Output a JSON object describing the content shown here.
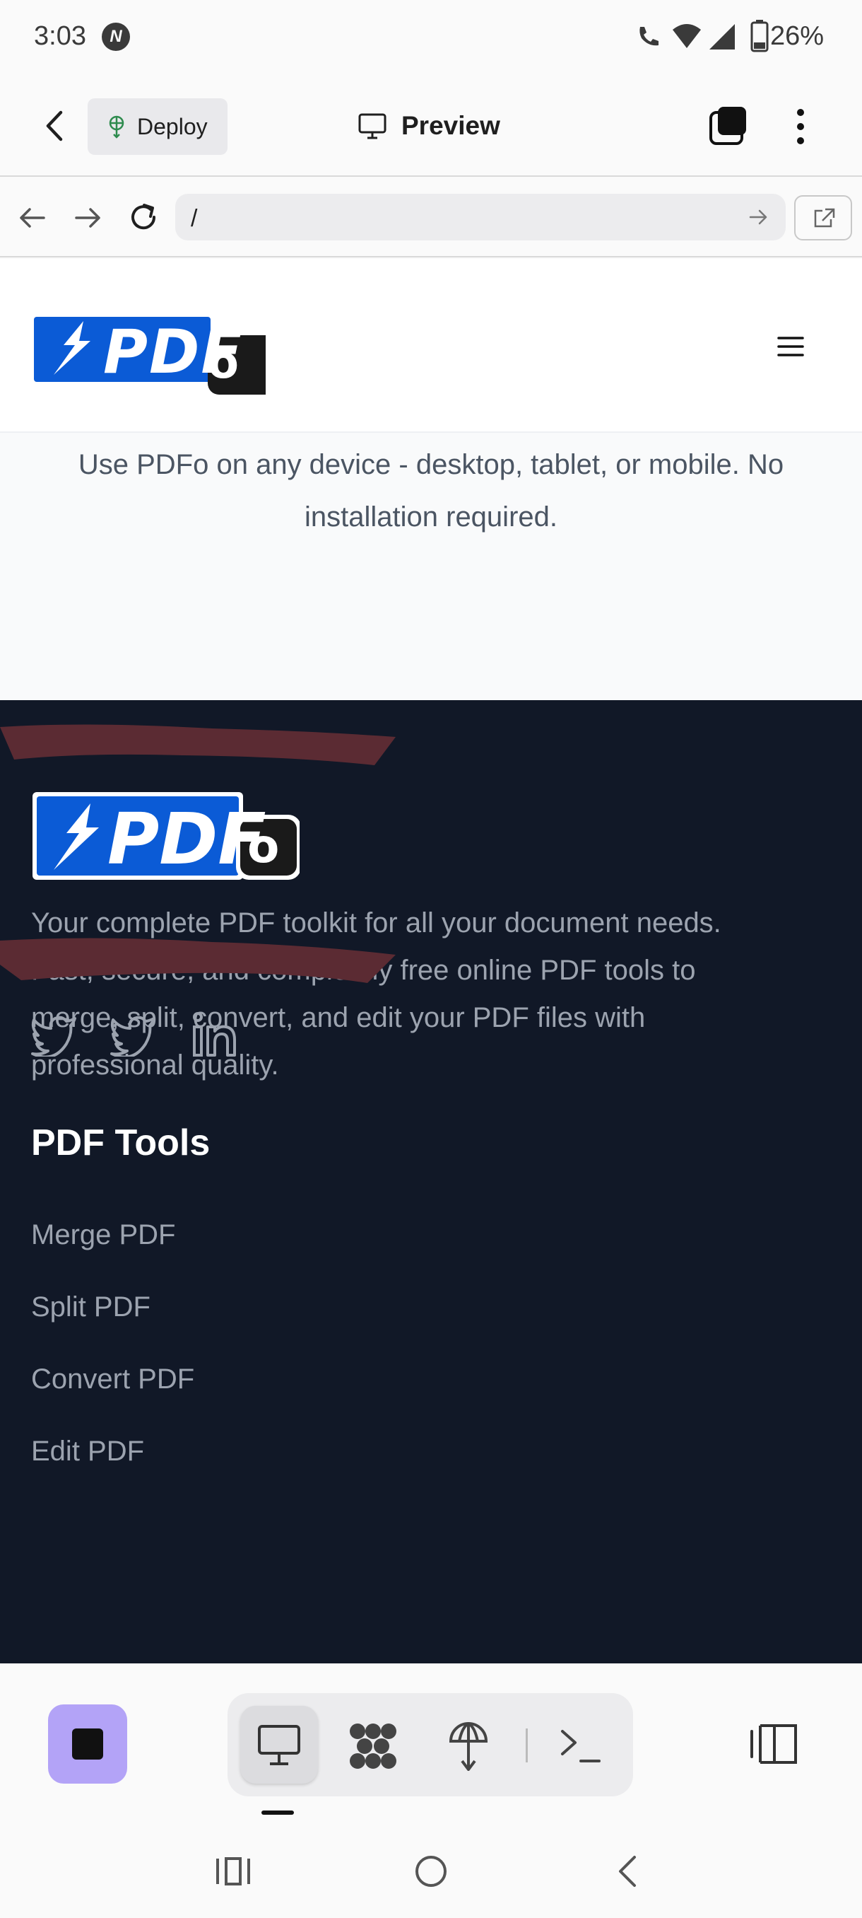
{
  "status_bar": {
    "time": "3:03",
    "battery": "26%"
  },
  "app_bar": {
    "deploy_label": "Deploy",
    "preview_label": "Preview"
  },
  "url_bar": {
    "url": "/"
  },
  "site": {
    "logo_text": "PDF",
    "logo_badge": "o",
    "devices_text_line1": "Use PDFo on any device - desktop, tablet, or mobile. No",
    "devices_text_line2": "installation required.",
    "footer": {
      "description_lines": [
        "Your complete PDF toolkit for all your document needs.",
        "Fast, secure, and completely free online PDF tools to",
        "merge, split, convert, and edit your PDF files with",
        "professional quality."
      ],
      "tools_heading": "PDF Tools",
      "tools_links": [
        "Merge PDF",
        "Split PDF",
        "Convert PDF",
        "Edit PDF"
      ]
    }
  },
  "bottom_toolbar": {
    "icons": [
      "stop-icon",
      "desktop-icon",
      "nodes-icon",
      "deploy-icon",
      "terminal-icon",
      "device-toggle-icon"
    ]
  },
  "colors": {
    "footer_bg": "#111827",
    "logo_blue": "#0b5bd6",
    "accent_purple": "#b3a3f7",
    "scribble": "#5b2b33"
  }
}
